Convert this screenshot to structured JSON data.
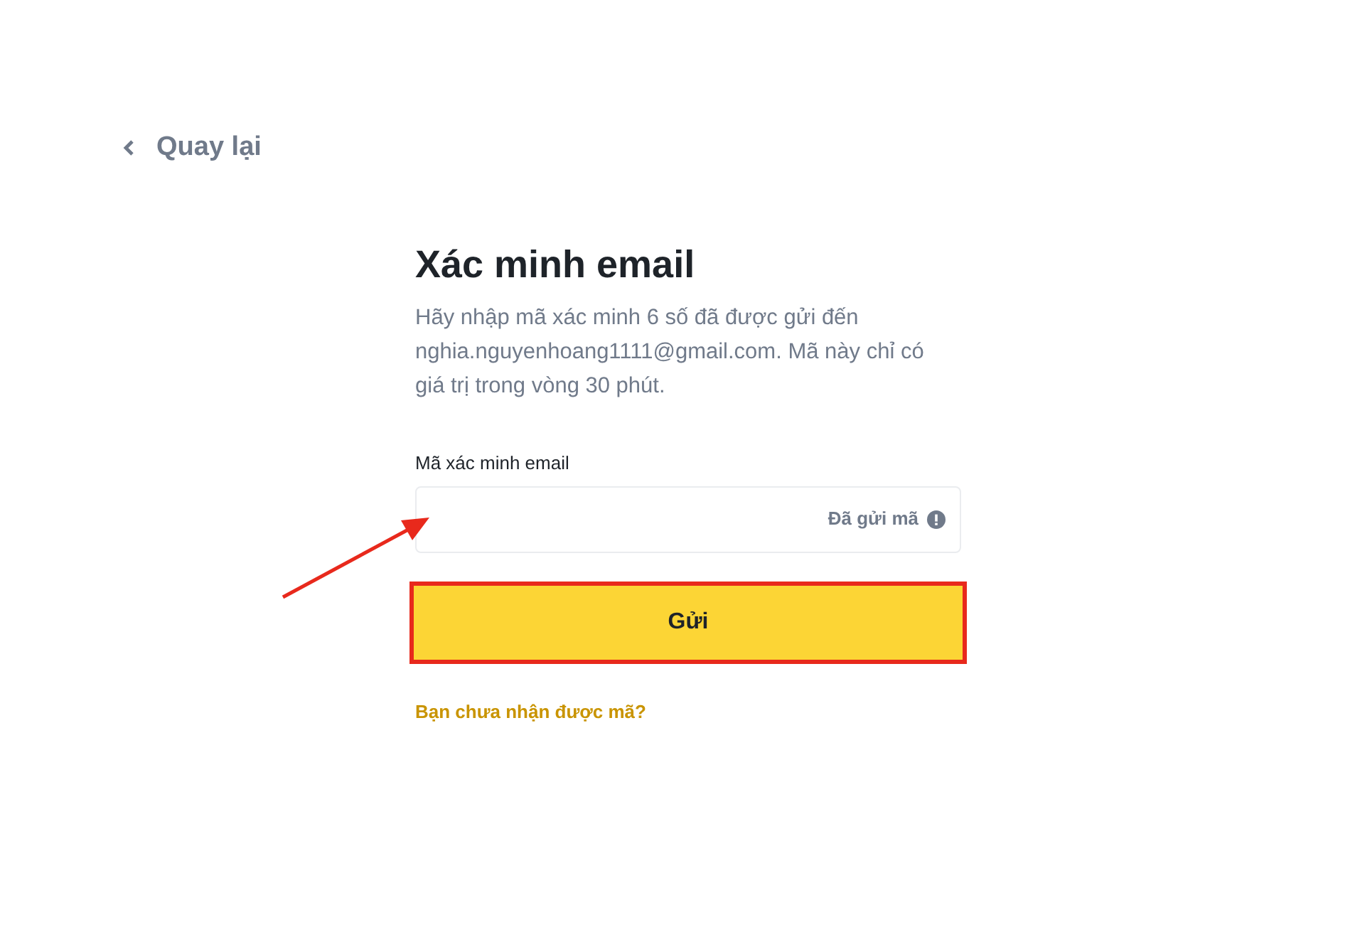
{
  "back_link": {
    "label": "Quay lại"
  },
  "title": "Xác minh email",
  "description": "Hãy nhập mã xác minh 6 số đã được gửi đến nghia.nguyenhoang1111@gmail.com. Mã này chỉ có giá trị trong vòng 30 phút.",
  "field": {
    "label": "Mã xác minh email",
    "status": "Đã gửi mã"
  },
  "submit_button": {
    "label": "Gửi",
    "highlighted": true
  },
  "help_link": "Bạn chưa nhận được mã?",
  "annotation": {
    "arrow": true
  }
}
